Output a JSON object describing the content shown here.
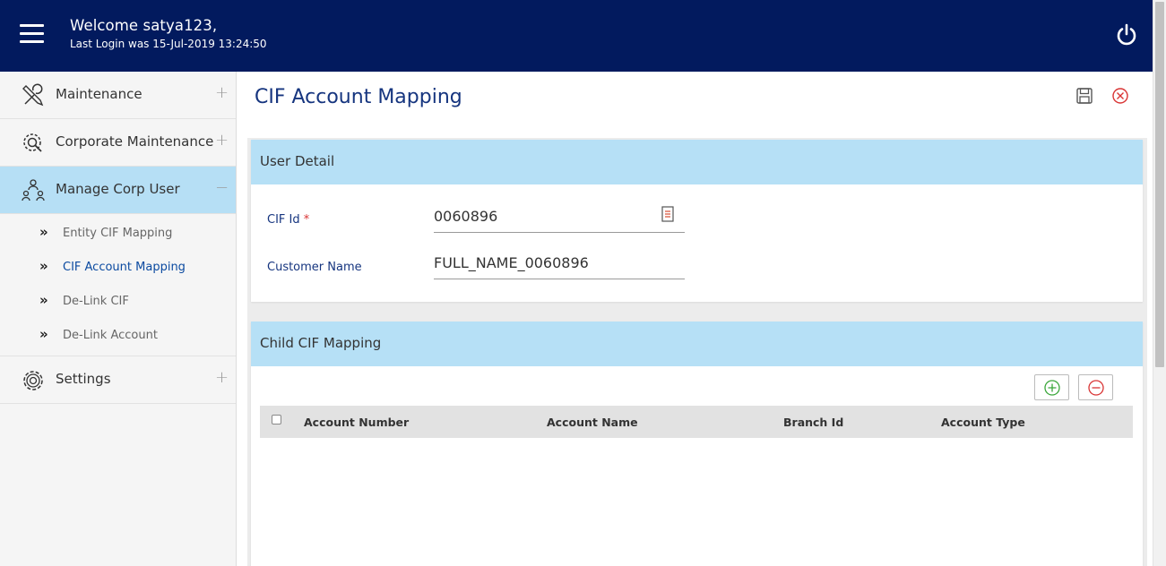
{
  "header": {
    "welcome": "Welcome satya123,",
    "last_login": "Last Login was 15-Jul-2019 13:24:50",
    "menu_icon": "hamburger-icon",
    "logout_icon": "power-icon"
  },
  "sidebar": {
    "items": [
      {
        "label": "Maintenance",
        "icon": "tools-icon",
        "toggle": "+"
      },
      {
        "label": "Corporate Maintenance",
        "icon": "gear-search-icon",
        "toggle": "+"
      },
      {
        "label": "Manage Corp User",
        "icon": "users-hierarchy-icon",
        "toggle": "−"
      },
      {
        "label": "Settings",
        "icon": "gear-icon",
        "toggle": "+"
      }
    ],
    "subitems": [
      {
        "label": "Entity CIF Mapping"
      },
      {
        "label": "CIF Account Mapping"
      },
      {
        "label": "De-Link CIF"
      },
      {
        "label": "De-Link Account"
      }
    ],
    "chevron": "»"
  },
  "main": {
    "title": "CIF Account Mapping",
    "user_detail": {
      "heading": "User Detail",
      "cif_label": "CIF Id",
      "required_mark": "*",
      "cif_value": "0060896",
      "customer_label": "Customer Name",
      "customer_value": "FULL_NAME_0060896"
    },
    "child_mapping": {
      "heading": "Child CIF Mapping",
      "columns": [
        "Account Number",
        "Account Name",
        "Branch Id",
        "Account Type"
      ]
    }
  },
  "colors": {
    "header_bg": "#021a5e",
    "accent_light": "#b6e0f6",
    "title_blue": "#16357f",
    "add_green": "#3aa63a",
    "remove_red": "#d93434"
  }
}
